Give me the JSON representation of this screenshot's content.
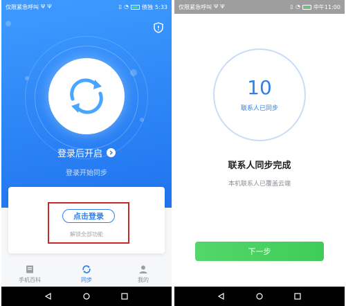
{
  "left": {
    "status_bar": {
      "carrier": "仅限紧急呼叫",
      "battery_text": "债独",
      "time": "5:33"
    },
    "hero": {
      "title": "登录后开启",
      "subtitle": "登录开始同步"
    },
    "login_card": {
      "button_label": "点击登录",
      "subtitle": "解锁全部功能"
    },
    "nav": [
      {
        "label": "手机百科",
        "icon": "book-icon"
      },
      {
        "label": "同步",
        "icon": "sync-icon"
      },
      {
        "label": "我的",
        "icon": "person-icon"
      }
    ]
  },
  "right": {
    "status_bar": {
      "carrier": "仅限紧急呼叫",
      "time": "中午11:00"
    },
    "count": "10",
    "count_label": "联系人已同步",
    "title": "联系人同步完成",
    "subtitle": "本机联系人已覆盖云端",
    "next_button": "下一步"
  },
  "colors": {
    "primary_blue": "#2f80ed",
    "green": "#4cd964",
    "highlight_red": "#c62828"
  }
}
